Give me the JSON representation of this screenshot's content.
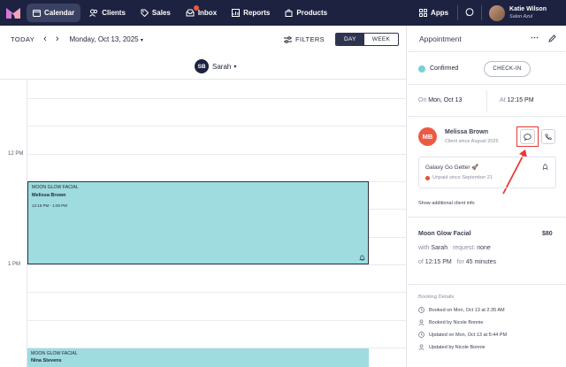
{
  "nav": {
    "items": [
      {
        "label": "Calendar",
        "icon": "calendar-icon",
        "active": true
      },
      {
        "label": "Clients",
        "icon": "clients-icon"
      },
      {
        "label": "Sales",
        "icon": "tag-icon"
      },
      {
        "label": "Inbox",
        "icon": "inbox-icon",
        "badge": true
      },
      {
        "label": "Reports",
        "icon": "reports-icon"
      },
      {
        "label": "Products",
        "icon": "bag-icon"
      }
    ],
    "apps_label": "Apps",
    "user": {
      "name": "Katie Wilson",
      "subtitle": "Salon Azul"
    }
  },
  "toolbar": {
    "today": "TODAY",
    "date": "Monday, Oct 13, 2025",
    "filters": "FILTERS",
    "day": "DAY",
    "week": "WEEK"
  },
  "staff": {
    "initials": "SB",
    "name": "Sarah"
  },
  "time_labels": {
    "noon": "12 PM",
    "one": "1 PM"
  },
  "appointments": [
    {
      "service": "MOON GLOW FACIAL",
      "client": "Melissa Brown",
      "time": "12:15 PM - 1:00 PM"
    },
    {
      "service": "MOON GLOW FACIAL",
      "client": "Nina Stevens"
    }
  ],
  "panel": {
    "title": "Appointment",
    "status": "Confirmed",
    "status_color": "#79d0d4",
    "checkin": "CHECK-IN",
    "on_label": "On",
    "on_value": "Mon, Oct 13",
    "at_label": "At",
    "at_value": "12:15 PM",
    "client": {
      "initials": "MB",
      "name": "Melissa Brown",
      "since": "Client since August 2025",
      "avatar_color": "#ec5a44"
    },
    "membership": {
      "name": "Galaxy Go Getter 🚀",
      "status": "Unpaid since September 21",
      "status_color": "#e8502f"
    },
    "show_info": "Show additional client info",
    "service": {
      "name": "Moon Glow Facial",
      "price": "$80",
      "with_label": "with",
      "staff": "Sarah",
      "request_label": "request:",
      "request_value": "none",
      "of_label": "of",
      "time": "12:15 PM",
      "for_label": "for",
      "duration": "45 minutes"
    },
    "booking": {
      "heading": "Booking Details",
      "entries": [
        "Booked on Mon, Oct 13 at 2:35 AM",
        "Booked by Nicole Bonnie",
        "Updated on Mon, Oct 13 at 5:44 PM",
        "Updated by Nicole Bonnie"
      ]
    }
  },
  "colors": {
    "nav_bg": "#1d2241",
    "appointment": "#9edcdf",
    "callout": "#e53935"
  }
}
